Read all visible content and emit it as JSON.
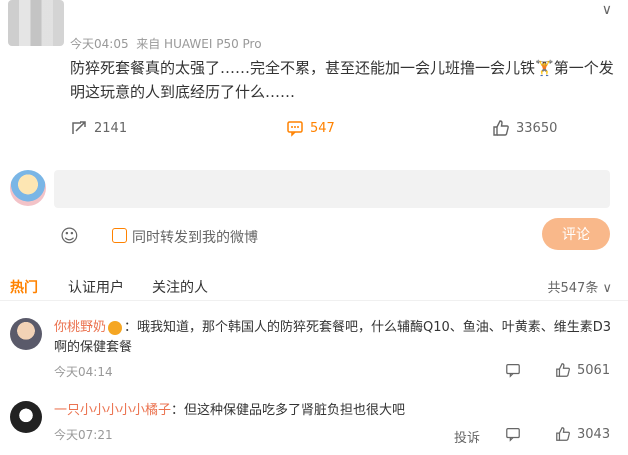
{
  "post": {
    "time": "今天04:05",
    "source": "来自 HUAWEI P50 Pro",
    "text": "防猝死套餐真的太强了……完全不累，甚至还能加一会儿班撸一会儿铁",
    "text_tail": "第一个发明这玩意的人到底经历了什么……",
    "repost_count": "2141",
    "comment_count": "547",
    "like_count": "33650"
  },
  "composer": {
    "placeholder": "",
    "repost_label": "同时转发到我的微博",
    "submit_label": "评论"
  },
  "tabs": [
    "热门",
    "认证用户",
    "关注的人"
  ],
  "total_label": "共547条",
  "comments": [
    {
      "name": "你桃野奶",
      "text": "：哦我知道，那个韩国人的防猝死套餐吧，什么辅酶Q10、鱼油、叶黄素、维生素D3啊的保健套餐",
      "time": "今天04:14",
      "likes": "5061",
      "report": ""
    },
    {
      "name": "一只小小小小小橘子",
      "text": "：但这种保健品吃多了肾脏负担也很大吧",
      "time": "今天07:21",
      "likes": "3043",
      "report": "投诉"
    }
  ],
  "colors": {
    "accent": "#ff8200",
    "name": "#eb7350",
    "submit": "#f9b88a"
  }
}
